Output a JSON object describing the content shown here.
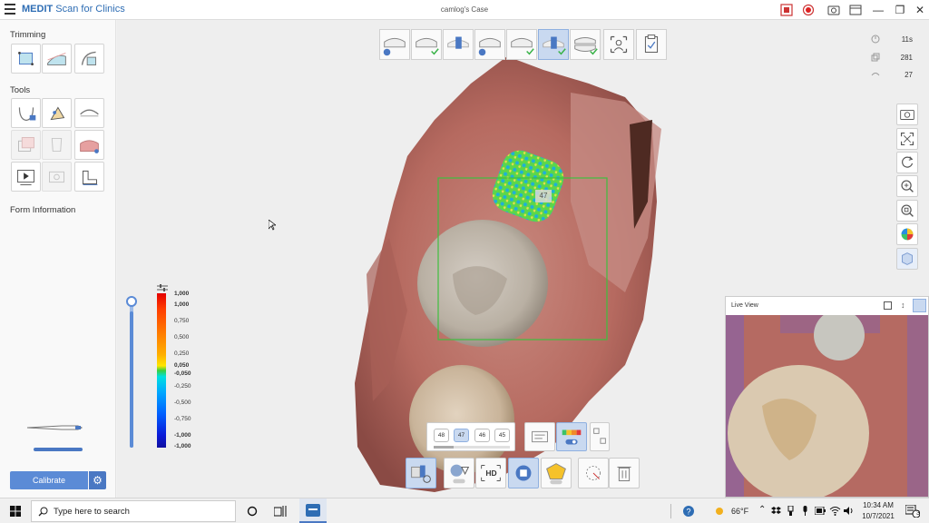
{
  "app": {
    "brand_bold": "MEDIT",
    "brand_rest": " Scan for Clinics",
    "case_title": "camlog's Case"
  },
  "left_panel": {
    "trimming_title": "Trimming",
    "tools_title": "Tools",
    "form_info_title": "Form Information",
    "calibrate_label": "Calibrate"
  },
  "colorbar": {
    "labels": [
      "1,000",
      "1,000",
      "0,750",
      "0,500",
      "0,250",
      "0,050",
      "-0,050",
      "-0,250",
      "-0,500",
      "-0,750",
      "-1,000",
      "-1,000"
    ]
  },
  "stats": {
    "time": "11s",
    "frames": "281",
    "count": "27"
  },
  "tooth_label": "47",
  "live_view": {
    "title": "Live View"
  },
  "tooth_selector": {
    "teeth": [
      "48",
      "47",
      "46",
      "45"
    ],
    "selected": "47"
  },
  "taskbar": {
    "search_placeholder": "Type here to search",
    "weather": "66°F",
    "time": "10:34 AM",
    "date": "10/7/2021",
    "notifications": "3"
  },
  "colors": {
    "accent": "#5b8bd6",
    "brand": "#2e6db4",
    "selection_box": "#3fbf3f"
  }
}
